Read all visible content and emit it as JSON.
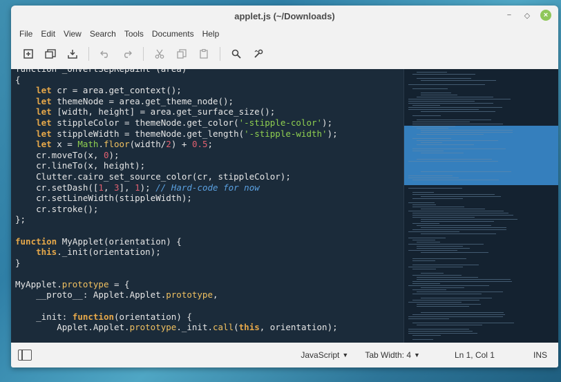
{
  "window": {
    "title": "applet.js (~/Downloads)"
  },
  "menu": [
    "File",
    "Edit",
    "View",
    "Search",
    "Tools",
    "Documents",
    "Help"
  ],
  "toolbar": {
    "icons": [
      "new-document-icon",
      "open-icon",
      "save-icon",
      "undo-icon",
      "redo-icon",
      "cut-icon",
      "copy-icon",
      "paste-icon",
      "search-icon",
      "tools-icon"
    ]
  },
  "editor": {
    "lines": [
      [
        {
          "t": "function _onVertSepRepaint (area)",
          "c": ""
        }
      ],
      [
        {
          "t": "{",
          "c": ""
        }
      ],
      [
        {
          "t": "    ",
          "c": ""
        },
        {
          "t": "let",
          "c": "kw"
        },
        {
          "t": " cr = area.get_context();",
          "c": ""
        }
      ],
      [
        {
          "t": "    ",
          "c": ""
        },
        {
          "t": "let",
          "c": "kw"
        },
        {
          "t": " themeNode = area.get_theme_node();",
          "c": ""
        }
      ],
      [
        {
          "t": "    ",
          "c": ""
        },
        {
          "t": "let",
          "c": "kw"
        },
        {
          "t": " [width, height] = area.get_surface_size();",
          "c": ""
        }
      ],
      [
        {
          "t": "    ",
          "c": ""
        },
        {
          "t": "let",
          "c": "kw"
        },
        {
          "t": " stippleColor = themeNode.get_color(",
          "c": ""
        },
        {
          "t": "'-stipple-color'",
          "c": "str"
        },
        {
          "t": ");",
          "c": ""
        }
      ],
      [
        {
          "t": "    ",
          "c": ""
        },
        {
          "t": "let",
          "c": "kw"
        },
        {
          "t": " stippleWidth = themeNode.get_length(",
          "c": ""
        },
        {
          "t": "'-stipple-width'",
          "c": "str"
        },
        {
          "t": ");",
          "c": ""
        }
      ],
      [
        {
          "t": "    ",
          "c": ""
        },
        {
          "t": "let",
          "c": "kw"
        },
        {
          "t": " x = ",
          "c": ""
        },
        {
          "t": "Math",
          "c": "str"
        },
        {
          "t": ".",
          "c": ""
        },
        {
          "t": "floor",
          "c": "fn"
        },
        {
          "t": "(width/",
          "c": ""
        },
        {
          "t": "2",
          "c": "num"
        },
        {
          "t": ") + ",
          "c": ""
        },
        {
          "t": "0.5",
          "c": "num"
        },
        {
          "t": ";",
          "c": ""
        }
      ],
      [
        {
          "t": "    cr.moveTo(x, ",
          "c": ""
        },
        {
          "t": "0",
          "c": "num"
        },
        {
          "t": ");",
          "c": ""
        }
      ],
      [
        {
          "t": "    cr.lineTo(x, height);",
          "c": ""
        }
      ],
      [
        {
          "t": "    Clutter.cairo_set_source_color(cr, stippleColor);",
          "c": ""
        }
      ],
      [
        {
          "t": "    cr.setDash([",
          "c": ""
        },
        {
          "t": "1",
          "c": "num"
        },
        {
          "t": ", ",
          "c": ""
        },
        {
          "t": "3",
          "c": "num"
        },
        {
          "t": "], ",
          "c": ""
        },
        {
          "t": "1",
          "c": "num"
        },
        {
          "t": "); ",
          "c": ""
        },
        {
          "t": "// Hard-code for now",
          "c": "cm"
        }
      ],
      [
        {
          "t": "    cr.setLineWidth(stippleWidth);",
          "c": ""
        }
      ],
      [
        {
          "t": "    cr.stroke();",
          "c": ""
        }
      ],
      [
        {
          "t": "};",
          "c": ""
        }
      ],
      [
        {
          "t": "",
          "c": ""
        }
      ],
      [
        {
          "t": "function",
          "c": "kw"
        },
        {
          "t": " MyApplet(orientation) {",
          "c": ""
        }
      ],
      [
        {
          "t": "    ",
          "c": ""
        },
        {
          "t": "this",
          "c": "kw"
        },
        {
          "t": "._init(orientation);",
          "c": ""
        }
      ],
      [
        {
          "t": "}",
          "c": ""
        }
      ],
      [
        {
          "t": "",
          "c": ""
        }
      ],
      [
        {
          "t": "MyApplet.",
          "c": ""
        },
        {
          "t": "prototype",
          "c": "fn"
        },
        {
          "t": " = {",
          "c": ""
        }
      ],
      [
        {
          "t": "    __proto__: Applet.Applet.",
          "c": ""
        },
        {
          "t": "prototype",
          "c": "fn"
        },
        {
          "t": ",",
          "c": ""
        }
      ],
      [
        {
          "t": "",
          "c": ""
        }
      ],
      [
        {
          "t": "    _init: ",
          "c": ""
        },
        {
          "t": "function",
          "c": "kw"
        },
        {
          "t": "(orientation) {",
          "c": ""
        }
      ],
      [
        {
          "t": "        Applet.Applet.",
          "c": ""
        },
        {
          "t": "prototype",
          "c": "fn"
        },
        {
          "t": "._init.",
          "c": ""
        },
        {
          "t": "call",
          "c": "fn"
        },
        {
          "t": "(",
          "c": ""
        },
        {
          "t": "this",
          "c": "kw"
        },
        {
          "t": ", orientation);",
          "c": ""
        }
      ]
    ]
  },
  "statusbar": {
    "language": "JavaScript",
    "tab_width": "Tab Width: 4",
    "position": "Ln 1, Col 1",
    "mode": "INS"
  }
}
